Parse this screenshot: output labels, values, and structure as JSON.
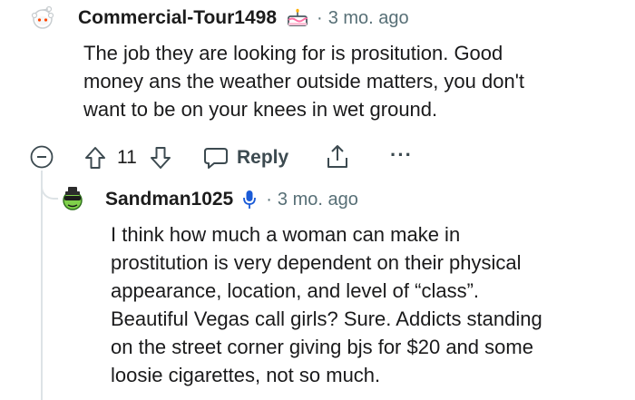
{
  "comments": [
    {
      "username": "Commercial-Tour1498",
      "separator": "·",
      "time_ago": "3 mo. ago",
      "body_lines": [
        "The job they are looking for is prositution. Good",
        "money ans the weather outside matters, you don't",
        "want to be on your knees in wet ground."
      ],
      "flair_icon": "cake-icon",
      "actions": {
        "upvote_icon": "arrow-up-icon",
        "score": "11",
        "downvote_icon": "arrow-down-icon",
        "reply_label": "Reply",
        "share_icon": "share-icon",
        "more_label": "···",
        "collapse_icon": "minus-circle-icon"
      }
    },
    {
      "username": "Sandman1025",
      "separator": "·",
      "time_ago": "3 mo. ago",
      "flair_icon": "microphone-icon",
      "body_lines": [
        "I think how much a woman can make in",
        "prostitution is very dependent on their physical",
        "appearance, location, and level of “class”.",
        "Beautiful Vegas call girls? Sure. Addicts standing",
        "on the street corner giving bjs for $20 and some",
        "loosie cigarettes, not so much."
      ]
    }
  ],
  "colors": {
    "text": "#1a1a1b",
    "meta": "#576f76",
    "thread_line": "#dde3e6",
    "icon": "#3c4a50"
  }
}
